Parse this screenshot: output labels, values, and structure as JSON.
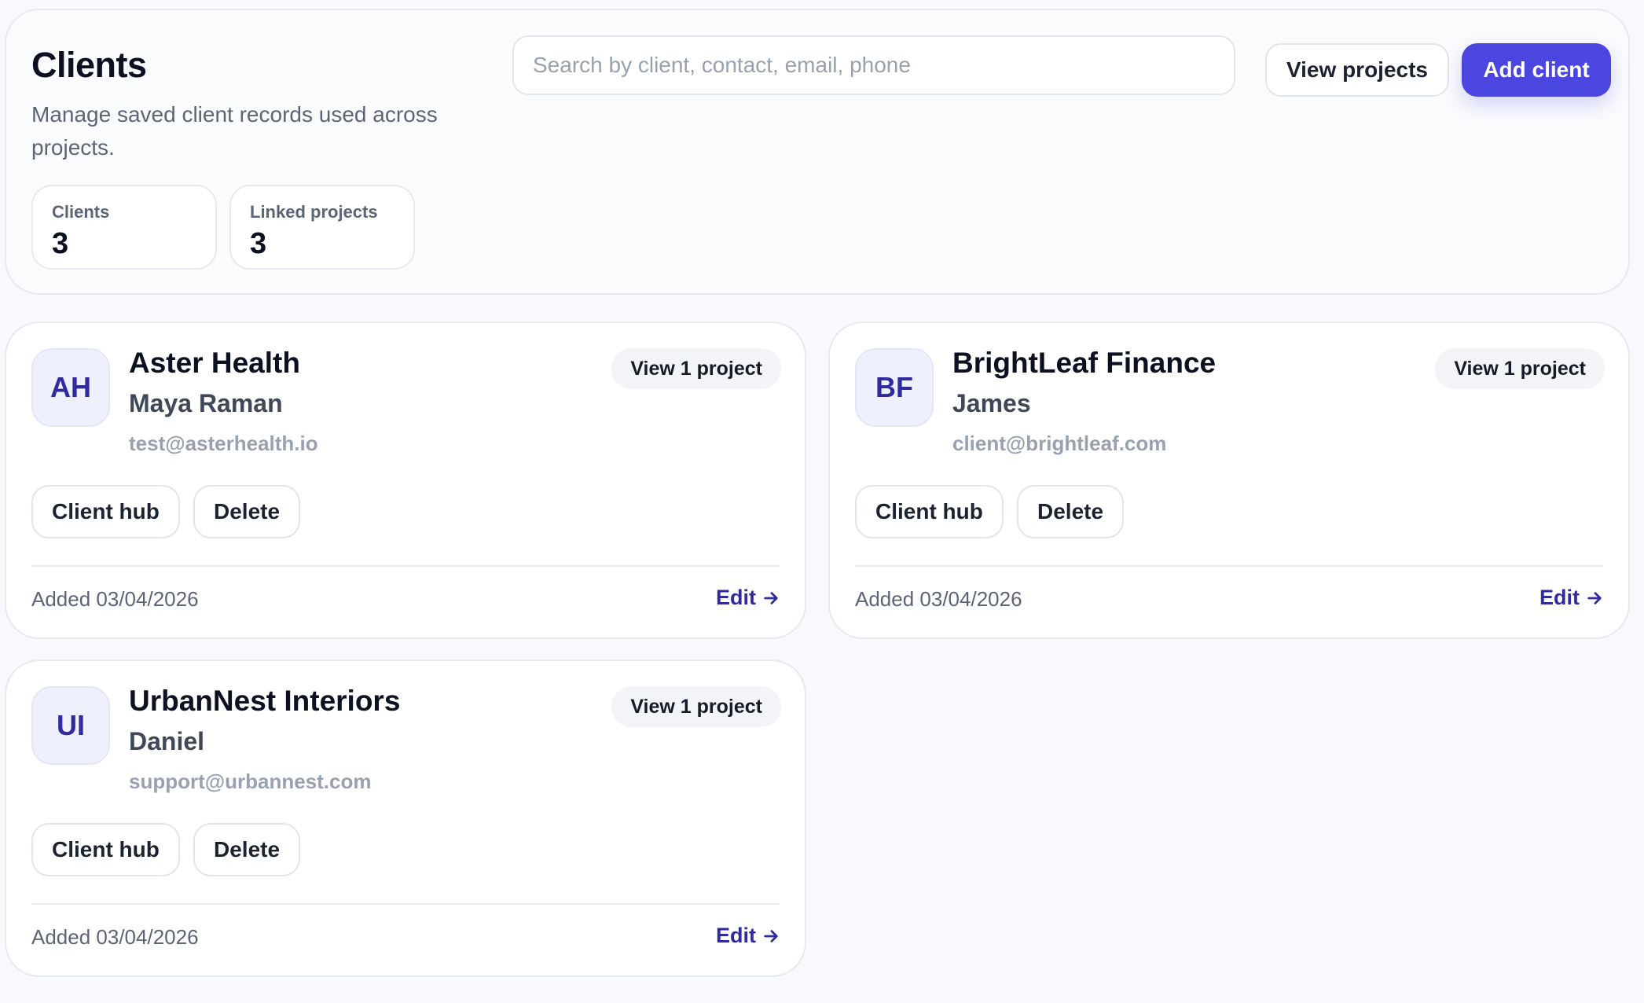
{
  "header": {
    "title": "Clients",
    "subtitle": "Manage saved client records used across projects.",
    "search_placeholder": "Search by client, contact, email, phone",
    "view_projects_label": "View projects",
    "add_client_label": "Add client",
    "stats": [
      {
        "label": "Clients",
        "value": "3"
      },
      {
        "label": "Linked projects",
        "value": "3"
      }
    ]
  },
  "clients": [
    {
      "initials": "AH",
      "name": "Aster Health",
      "contact": "Maya Raman",
      "email": "test@asterhealth.io",
      "projects_label": "View 1 project",
      "hub_label": "Client hub",
      "delete_label": "Delete",
      "added": "Added 03/04/2026",
      "edit_label": "Edit"
    },
    {
      "initials": "BF",
      "name": "BrightLeaf Finance",
      "contact": "James",
      "email": "client@brightleaf.com",
      "projects_label": "View 1 project",
      "hub_label": "Client hub",
      "delete_label": "Delete",
      "added": "Added 03/04/2026",
      "edit_label": "Edit"
    },
    {
      "initials": "UI",
      "name": "UrbanNest Interiors",
      "contact": "Daniel",
      "email": "support@urbannest.com",
      "projects_label": "View 1 project",
      "hub_label": "Client hub",
      "delete_label": "Delete",
      "added": "Added 03/04/2026",
      "edit_label": "Edit"
    }
  ],
  "icons": {
    "edit_arrow": "arrow-right-icon"
  },
  "colors": {
    "primary": "#4b46e0",
    "accent_text": "#2f2a9e",
    "avatar_bg": "#eef0fe"
  }
}
